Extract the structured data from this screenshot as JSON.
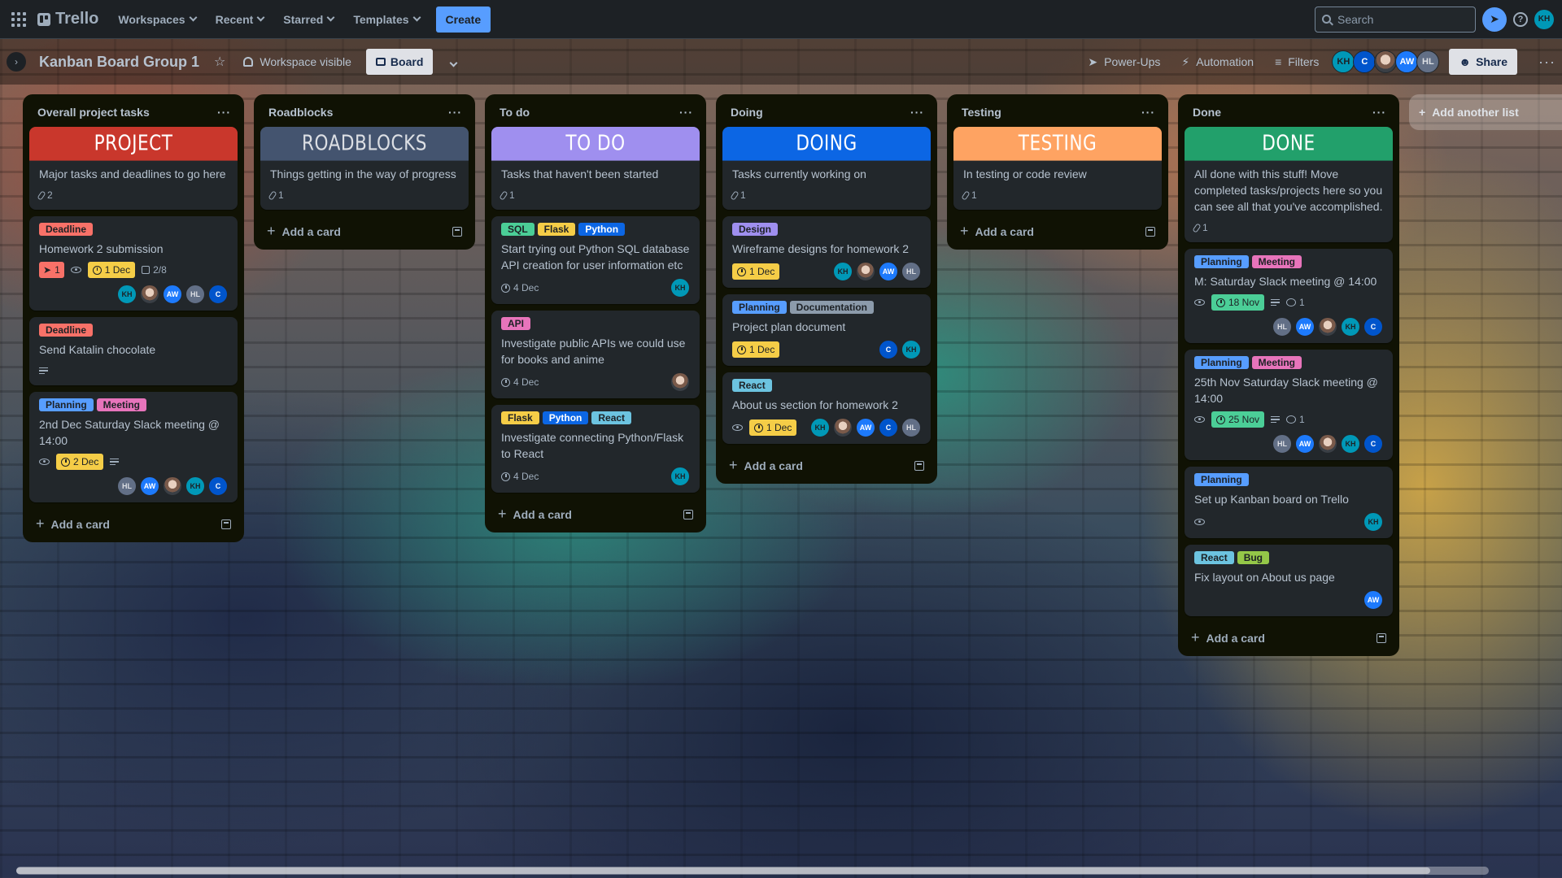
{
  "topnav": {
    "logo": "Trello",
    "items": [
      "Workspaces",
      "Recent",
      "Starred",
      "Templates"
    ],
    "create": "Create",
    "search_placeholder": "Search",
    "user_initials": "KH"
  },
  "board": {
    "title": "Kanban Board Group 1",
    "visibility": "Workspace visible",
    "view": "Board",
    "power_ups": "Power-Ups",
    "automation": "Automation",
    "filters": "Filters",
    "share": "Share",
    "members": [
      "KH",
      "C",
      "",
      "AW",
      "HL"
    ]
  },
  "colors": {
    "project": "#c9372c",
    "roadblocks": "#44546f",
    "todo": "#9f8fef",
    "doing": "#0c66e4",
    "testing": "#fea362",
    "done": "#1f845a"
  },
  "lists": [
    {
      "title": "Overall project tasks",
      "cover": "PROJECT",
      "cover_desc": "Major tasks and deadlines to go here",
      "cover_count": "2",
      "cards": [
        {
          "labels": [
            "Deadline"
          ],
          "title": "Homework 2 submission",
          "votes": "1",
          "due": "1 Dec",
          "checklist": "2/8"
        },
        {
          "labels": [
            "Deadline"
          ],
          "title": "Send Katalin chocolate"
        },
        {
          "labels": [
            "Planning",
            "Meeting"
          ],
          "title": "2nd Dec Saturday Slack meeting @ 14:00",
          "due": "2 Dec"
        }
      ],
      "add_card": "Add a card"
    },
    {
      "title": "Roadblocks",
      "cover": "ROADBLOCKS",
      "cover_desc": "Things getting in the way of progress",
      "cover_count": "1",
      "add_card": "Add a card"
    },
    {
      "title": "To do",
      "cover": "TO DO",
      "cover_desc": "Tasks that haven't been started",
      "cover_count": "1",
      "cards": [
        {
          "labels": [
            "SQL",
            "Flask",
            "Python"
          ],
          "title": "Start trying out Python SQL database API creation for user information etc",
          "date": "4 Dec"
        },
        {
          "labels": [
            "API"
          ],
          "title": "Investigate public APIs we could use for books and anime",
          "date": "4 Dec"
        },
        {
          "labels": [
            "Flask",
            "Python",
            "React"
          ],
          "title": "Investigate connecting Python/Flask to React",
          "date": "4 Dec"
        }
      ],
      "add_card": "Add a card"
    },
    {
      "title": "Doing",
      "cover": "DOING",
      "cover_desc": "Tasks currently working on",
      "cover_count": "1",
      "cards": [
        {
          "labels": [
            "Design"
          ],
          "title": "Wireframe designs for homework 2",
          "due": "1 Dec"
        },
        {
          "labels": [
            "Planning",
            "Documentation"
          ],
          "title": "Project plan document",
          "due": "1 Dec"
        },
        {
          "labels": [
            "React"
          ],
          "title": "About us section for homework 2",
          "due": "1 Dec"
        }
      ],
      "add_card": "Add a card"
    },
    {
      "title": "Testing",
      "cover": "TESTING",
      "cover_desc": "In testing or code review",
      "cover_count": "1",
      "add_card": "Add a card"
    },
    {
      "title": "Done",
      "cover": "DONE",
      "cover_desc": "All done with this stuff! Move completed tasks/projects here so you can see all that you've accomplished.",
      "cover_count": "1",
      "cards": [
        {
          "labels": [
            "Planning",
            "Meeting"
          ],
          "title": "M: Saturday Slack meeting @ 14:00",
          "due": "18 Nov",
          "comments": "1"
        },
        {
          "labels": [
            "Planning",
            "Meeting"
          ],
          "title": "25th Nov Saturday Slack meeting @ 14:00",
          "due": "25 Nov",
          "comments": "1"
        },
        {
          "labels": [
            "Planning"
          ],
          "title": "Set up Kanban board on Trello"
        },
        {
          "labels": [
            "React",
            "Bug"
          ],
          "title": "Fix layout on About us page"
        }
      ],
      "add_card": "Add a card"
    }
  ],
  "add_list": "Add another list"
}
